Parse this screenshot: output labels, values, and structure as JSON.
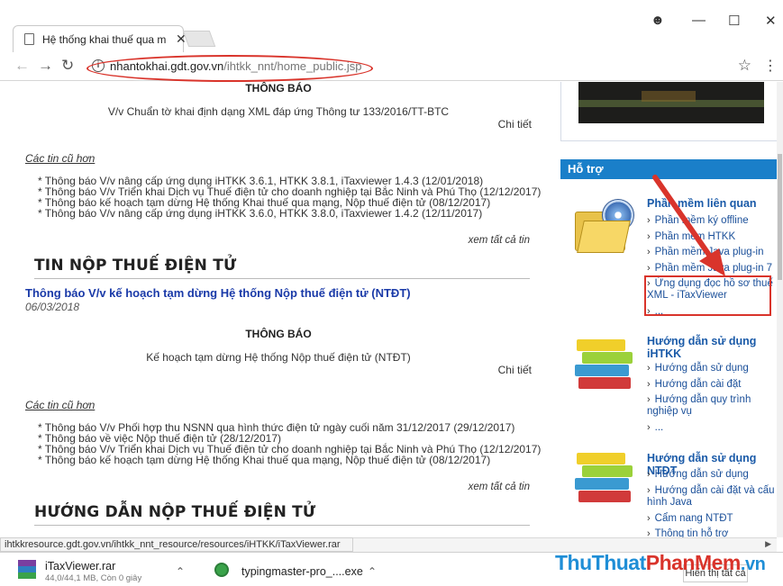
{
  "browser": {
    "tab_title": "Hệ thống khai thuế qua m",
    "tab_close": "✕",
    "url_host": "nhantokhai.gdt.gov.vn",
    "url_path": "/ihtkk_nnt/home_public.jsp",
    "status_url": "ihtkkresource.gdt.gov.vn/ihtkk_nnt_resource/resources/iHTKK/iTaxViewer.rar"
  },
  "main": {
    "notice1_heading": "THÔNG BÁO",
    "notice1_text": "V/v Chuẩn tờ khai định dạng XML đáp ứng Thông tư 133/2016/TT-BTC",
    "detail_label": "Chi tiết",
    "older_label": "Các tin cũ hơn",
    "older_list_1": [
      "* Thông báo V/v nâng cấp ứng dụng iHTKK 3.6.1, HTKK 3.8.1, iTaxviewer 1.4.3 (12/01/2018)",
      "* Thông báo V/v Triển khai Dịch vụ Thuế điện tử cho doanh nghiệp tại Bắc Ninh và Phú Thọ (12/12/2017)",
      "* Thông báo kế hoạch tạm dừng Hệ thống Khai thuế qua mạng, Nộp thuế điện tử (08/12/2017)",
      "* Thông báo V/v nâng cấp ứng dụng iHTKK 3.6.0, HTKK 3.8.0, iTaxviewer 1.4.2 (12/11/2017)"
    ],
    "see_all": "xem tất cả tin",
    "section_ntdt": "TIN NỘP THUẾ ĐIỆN TỬ",
    "ntdt_link": "Thông báo V/v kế hoạch tạm dừng Hệ thống Nộp thuế điện tử (NTĐT)",
    "ntdt_date": "06/03/2018",
    "notice2_heading": "THÔNG BÁO",
    "notice2_text": "Kế hoạch tạm dừng Hệ thống Nộp thuế điện tử (NTĐT)",
    "older_list_2": [
      "* Thông báo V/v Phối hợp thu NSNN qua hình thức điện tử ngày cuối năm 31/12/2017 (29/12/2017)",
      "* Thông báo về việc Nộp thuế điện tử (28/12/2017)",
      "* Thông báo V/v Triển khai Dịch vụ Thuế điện tử cho doanh nghiệp tại Bắc Ninh và Phú Thọ (12/12/2017)",
      "* Thông báo kế hoạch tạm dừng Hệ thống Khai thuế qua mạng, Nộp thuế điện tử (08/12/2017)"
    ],
    "section_huongdan": "HƯỚNG DẪN NỘP THUẾ ĐIỆN TỬ"
  },
  "sidebar": {
    "support_header": "Hỗ trợ",
    "software_title": "Phần mềm liên quan",
    "software_items": [
      "Phần mềm ký offline",
      "Phần mềm HTKK",
      "Phần mềm Java plug-in",
      "Phần mềm Java plug-in 7",
      "Ứng dụng đọc hồ sơ thuế XML - iTaxViewer",
      "..."
    ],
    "ihtkk_title": "Hướng dẫn sử dụng iHTKK",
    "ihtkk_items": [
      "Hướng dẫn sử dụng",
      "Hướng dẫn cài đặt",
      "Hướng dẫn quy trình nghiệp vụ",
      "..."
    ],
    "ntdt_title": "Hướng dẫn sử dụng NTĐT",
    "ntdt_items": [
      "Hướng dẫn sử dụng",
      "Hướng dẫn cài đặt và cấu hình Java",
      "Cẩm nang NTĐT",
      "Thông tin hỗ trợ"
    ]
  },
  "downloads": {
    "item1_name": "iTaxViewer.rar",
    "item1_status": "44,0/44,1 MB, Còn 0 giây",
    "item2_name": "typingmaster-pro_....exe",
    "show_all": "Hiển thị tất cả"
  },
  "watermark": {
    "part1": "ThuThuat",
    "part2": "PhanMem",
    "part3": ".vn"
  },
  "colors": {
    "highlight_red": "#d9342b",
    "link_blue": "#1a3aa8",
    "support_header_bg": "#1a7fc9"
  }
}
